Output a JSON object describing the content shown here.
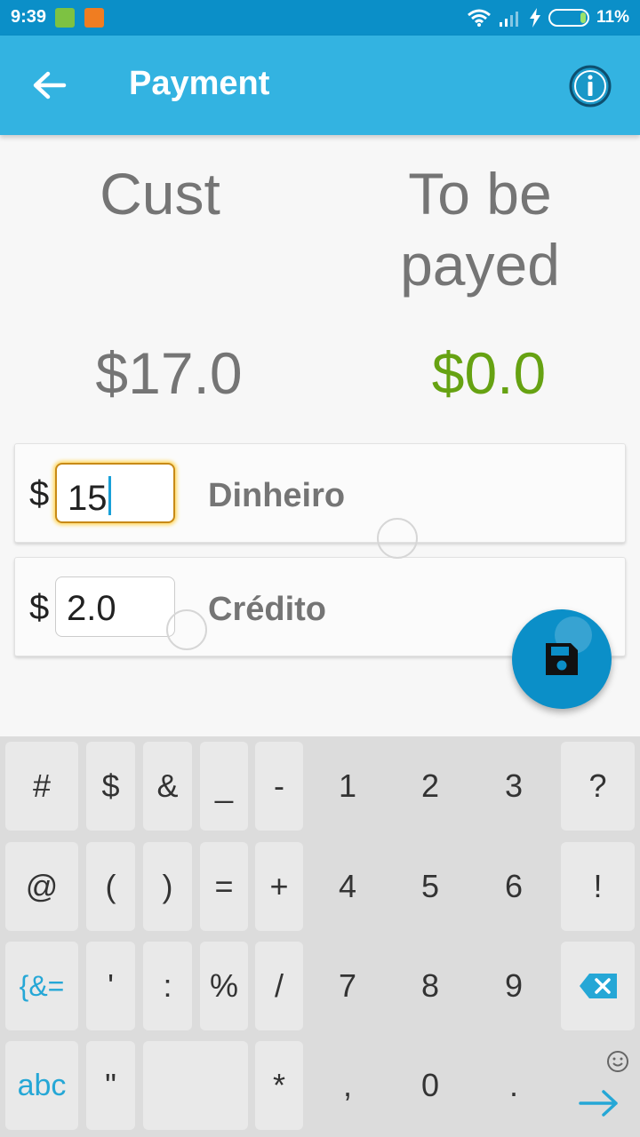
{
  "status_bar": {
    "time": "9:39",
    "battery_percent": "11%"
  },
  "app_bar": {
    "title": "Payment",
    "back_icon": "arrow-left-icon",
    "info_icon": "info-circle-icon"
  },
  "summary": {
    "cust_label": "Cust",
    "to_be_payed_label_line1": "To be",
    "to_be_payed_label_line2": "payed",
    "cust_amount": "$17.0",
    "to_be_payed_amount": "$0.0"
  },
  "payments": [
    {
      "currency": "$",
      "value": "15",
      "method": "Dinheiro"
    },
    {
      "currency": "$",
      "value": "2.0",
      "method": "Crédito"
    }
  ],
  "fab": {
    "icon": "save-icon"
  },
  "keyboard": {
    "rows": [
      [
        "#",
        "$",
        "&",
        "_",
        "-",
        "1",
        "2",
        "3",
        "?"
      ],
      [
        "@",
        "(",
        ")",
        "=",
        "+",
        "4",
        "5",
        "6",
        "!"
      ],
      [
        "{&=",
        "'",
        ":",
        "%",
        "/",
        "7",
        "8",
        "9",
        "backspace"
      ],
      [
        "abc",
        "\"",
        "",
        "*",
        ",",
        "0",
        ".",
        "enter"
      ]
    ]
  },
  "colors": {
    "status_bar": "#0b8fc8",
    "app_bar": "#33b3e1",
    "positive_amount": "#66a212",
    "accent": "#25a7d6"
  }
}
